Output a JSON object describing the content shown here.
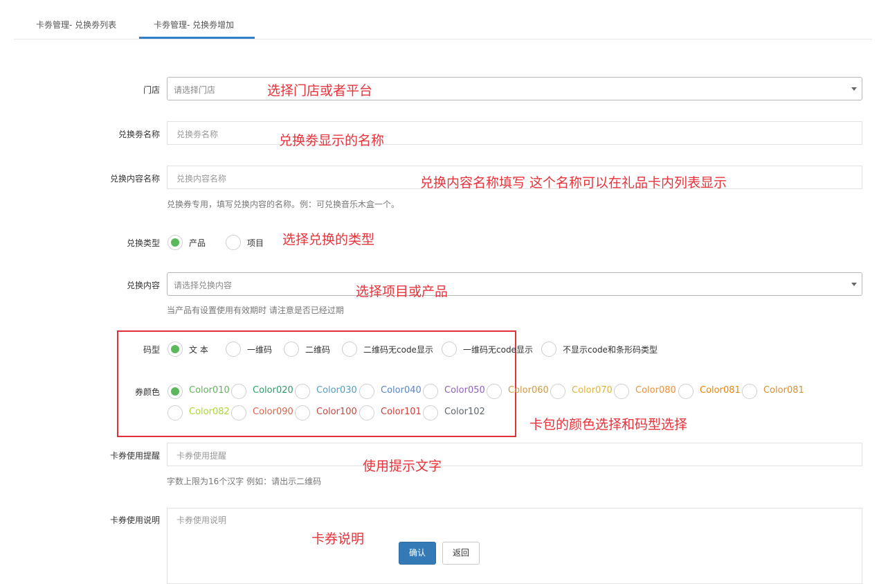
{
  "tabs": [
    {
      "label": "卡劵管理- 兑换劵列表"
    },
    {
      "label": "卡劵管理- 兑换劵增加"
    }
  ],
  "form": {
    "store": {
      "label": "门店",
      "placeholder": "请选择门店",
      "annotation": "选择门店或者平台"
    },
    "coupon_name": {
      "label": "兑换劵名称",
      "placeholder": "兑换劵名称",
      "annotation": "兑换劵显示的名称"
    },
    "content_name": {
      "label": "兑换内容名称",
      "placeholder": "兑换内容名称",
      "help": "兑换券专用，填写兑换内容的名称。例：可兑换音乐木盒一个。",
      "annotation": "兑换内容名称填写 这个名称可以在礼品卡内列表显示"
    },
    "exchange_type": {
      "label": "兑换类型",
      "options": [
        "产品",
        "项目"
      ],
      "selected": "产品",
      "annotation": "选择兑换的类型"
    },
    "exchange_content": {
      "label": "兑换内容",
      "placeholder": "请选择兑换内容",
      "help": "当产品有设置使用有效期时 请注意是否已经过期",
      "annotation": "选择项目或产品"
    },
    "code_type": {
      "label": "码型",
      "options": [
        "文 本",
        "一维码",
        "二维码",
        "二维码无code显示",
        "一维码无code显示",
        "不显示code和条形码类型"
      ],
      "selected": "文 本"
    },
    "coupon_color": {
      "label": "券颜色",
      "options": [
        {
          "name": "Color010",
          "color": "#63b359"
        },
        {
          "name": "Color020",
          "color": "#2c9f67"
        },
        {
          "name": "Color030",
          "color": "#509fc9"
        },
        {
          "name": "Color040",
          "color": "#5885cf"
        },
        {
          "name": "Color050",
          "color": "#9062c0"
        },
        {
          "name": "Color060",
          "color": "#d09a45"
        },
        {
          "name": "Color070",
          "color": "#e4b138"
        },
        {
          "name": "Color080",
          "color": "#ee903c"
        },
        {
          "name": "Color081",
          "color": "#f08500"
        },
        {
          "name": "Color081",
          "color": "#dd8f2e"
        },
        {
          "name": "Color082",
          "color": "#a9d92d"
        },
        {
          "name": "Color090",
          "color": "#dd6549"
        },
        {
          "name": "Color100",
          "color": "#cc463d"
        },
        {
          "name": "Color101",
          "color": "#cf3e36"
        },
        {
          "name": "Color102",
          "color": "#5e6671"
        }
      ],
      "selected": "Color010",
      "annotation": "卡包的颜色选择和码型选择"
    },
    "usage_notice": {
      "label": "卡券使用提醒",
      "placeholder": "卡券使用提醒",
      "help": "字数上限为16个汉字 例如：请出示二维码",
      "annotation": "使用提示文字"
    },
    "usage_desc": {
      "label": "卡券使用说明",
      "placeholder": "卡券使用说明",
      "annotation": "卡券说明"
    }
  },
  "buttons": {
    "confirm": "确认",
    "back": "返回"
  },
  "colors": {
    "accent": "#337ab7",
    "radio_checked": "#5cb85c",
    "annotation_red": "#e8333a"
  }
}
